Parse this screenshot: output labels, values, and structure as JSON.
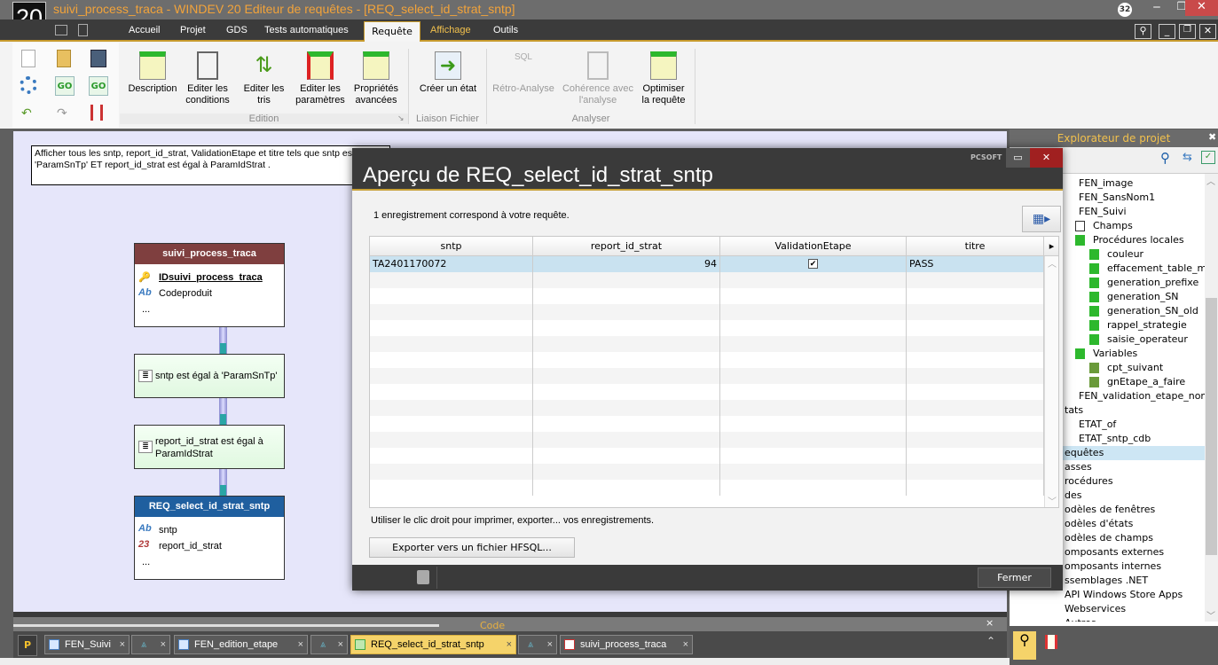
{
  "window": {
    "logo": "20",
    "title": "suivi_process_traca - WINDEV 20  Editeur de requêtes - [REQ_select_id_strat_sntp]",
    "notif_count": "32"
  },
  "menu": {
    "tabs": [
      "Accueil",
      "Projet",
      "GDS",
      "Tests automatiques",
      "Requête",
      "Affichage",
      "Outils"
    ],
    "active": "Requête"
  },
  "ribbon": {
    "buttons": [
      {
        "label1": "Description",
        "label2": ""
      },
      {
        "label1": "Editer les",
        "label2": "conditions"
      },
      {
        "label1": "Editer les",
        "label2": "tris"
      },
      {
        "label1": "Editer les",
        "label2": "paramètres"
      },
      {
        "label1": "Propriétés",
        "label2": "avancées"
      },
      {
        "label1": "Créer un état",
        "label2": ""
      },
      {
        "label1": "Rétro-Analyse",
        "label2": ""
      },
      {
        "label1": "Cohérence avec",
        "label2": "l'analyse"
      },
      {
        "label1": "Optimiser",
        "label2": "la requête"
      }
    ],
    "groups": [
      "Edition",
      "Liaison Fichier",
      "Analyser"
    ],
    "sql_icon_text": "SQL",
    "go_text": "GO"
  },
  "diagram": {
    "description": "Afficher tous les sntp, report_id_strat, ValidationEtape et titre  tels que sntp est égal à 'ParamSnTp' ET report_id_strat  est égal à ParamIdStrat .",
    "source_table": {
      "name": "suivi_process_traca",
      "fields": [
        "IDsuivi_process_traca",
        "Codeproduit"
      ],
      "more": "..."
    },
    "conditions": [
      "sntp  est égal à 'ParamSnTp'",
      "report_id_strat  est égal à ParamIdStrat"
    ],
    "result": {
      "name": "REQ_select_id_strat_sntp",
      "fields": [
        "sntp",
        "report_id_strat"
      ],
      "more": "...",
      "type_icons": [
        "Ab",
        "Ab",
        "23"
      ]
    },
    "colors": {
      "source_header": "#7f3f3f",
      "result_header": "#1f5f9f",
      "canvas": "#e6e6fa"
    }
  },
  "dialog": {
    "brand": "PCSOFT",
    "title": "Aperçu de REQ_select_id_strat_sntp",
    "count_text": "1 enregistrement correspond à votre requête.",
    "columns": [
      "sntp",
      "report_id_strat",
      "ValidationEtape",
      "titre"
    ],
    "rows": [
      {
        "sntp": "TA2401170072",
        "report_id_strat": "94",
        "ValidationEtape": true,
        "titre": "PASS"
      }
    ],
    "hint": "Utiliser le clic droit pour imprimer, exporter... vos enregistrements.",
    "export_button": "Exporter vers un fichier HFSQL...",
    "close_button": "Fermer",
    "checkmark": "✔"
  },
  "explorer": {
    "title": "Explorateur de projet",
    "items": [
      {
        "label": "FEN_image",
        "level": 1
      },
      {
        "label": "FEN_SansNom1",
        "level": 1
      },
      {
        "label": "FEN_Suivi",
        "level": 1
      },
      {
        "label": "Champs",
        "level": 2,
        "icon": "Ab"
      },
      {
        "label": "Procédures locales",
        "level": 2
      },
      {
        "label": "couleur",
        "level": 3
      },
      {
        "label": "effacement_table_mis",
        "level": 3
      },
      {
        "label": "generation_prefixe",
        "level": 3
      },
      {
        "label": "generation_SN",
        "level": 3
      },
      {
        "label": "generation_SN_old",
        "level": 3
      },
      {
        "label": "rappel_strategie",
        "level": 3
      },
      {
        "label": "saisie_operateur",
        "level": 3
      },
      {
        "label": "Variables",
        "level": 2
      },
      {
        "label": "cpt_suivant",
        "level": 3
      },
      {
        "label": "gnEtape_a_faire",
        "level": 3
      },
      {
        "label": "FEN_validation_etape_non_",
        "level": 1
      },
      {
        "label": "tats",
        "level": 0
      },
      {
        "label": "ETAT_of",
        "level": 1
      },
      {
        "label": "ETAT_sntp_cdb",
        "level": 1
      },
      {
        "label": "equêtes",
        "level": 0,
        "selected": true
      },
      {
        "label": "asses",
        "level": 0
      },
      {
        "label": "rocédures",
        "level": 0
      },
      {
        "label": "des",
        "level": 0
      },
      {
        "label": "odèles de fenêtres",
        "level": 0
      },
      {
        "label": "odèles d'états",
        "level": 0
      },
      {
        "label": "odèles de champs",
        "level": 0
      },
      {
        "label": "omposants externes",
        "level": 0
      },
      {
        "label": "omposants internes",
        "level": 0
      },
      {
        "label": "ssemblages .NET",
        "level": 0
      },
      {
        "label": "API Windows Store Apps",
        "level": 0
      },
      {
        "label": "Webservices",
        "level": 0
      },
      {
        "label": "Autres",
        "level": 0
      }
    ]
  },
  "bottom": {
    "code_pane_title": "Code",
    "tabs": [
      {
        "label": "FEN_Suivi"
      },
      {
        "label": ""
      },
      {
        "label": "FEN_edition_etape"
      },
      {
        "label": ""
      },
      {
        "label": "REQ_select_id_strat_sntp",
        "active": true
      },
      {
        "label": ""
      },
      {
        "label": "suivi_process_traca"
      }
    ],
    "close": "×"
  }
}
